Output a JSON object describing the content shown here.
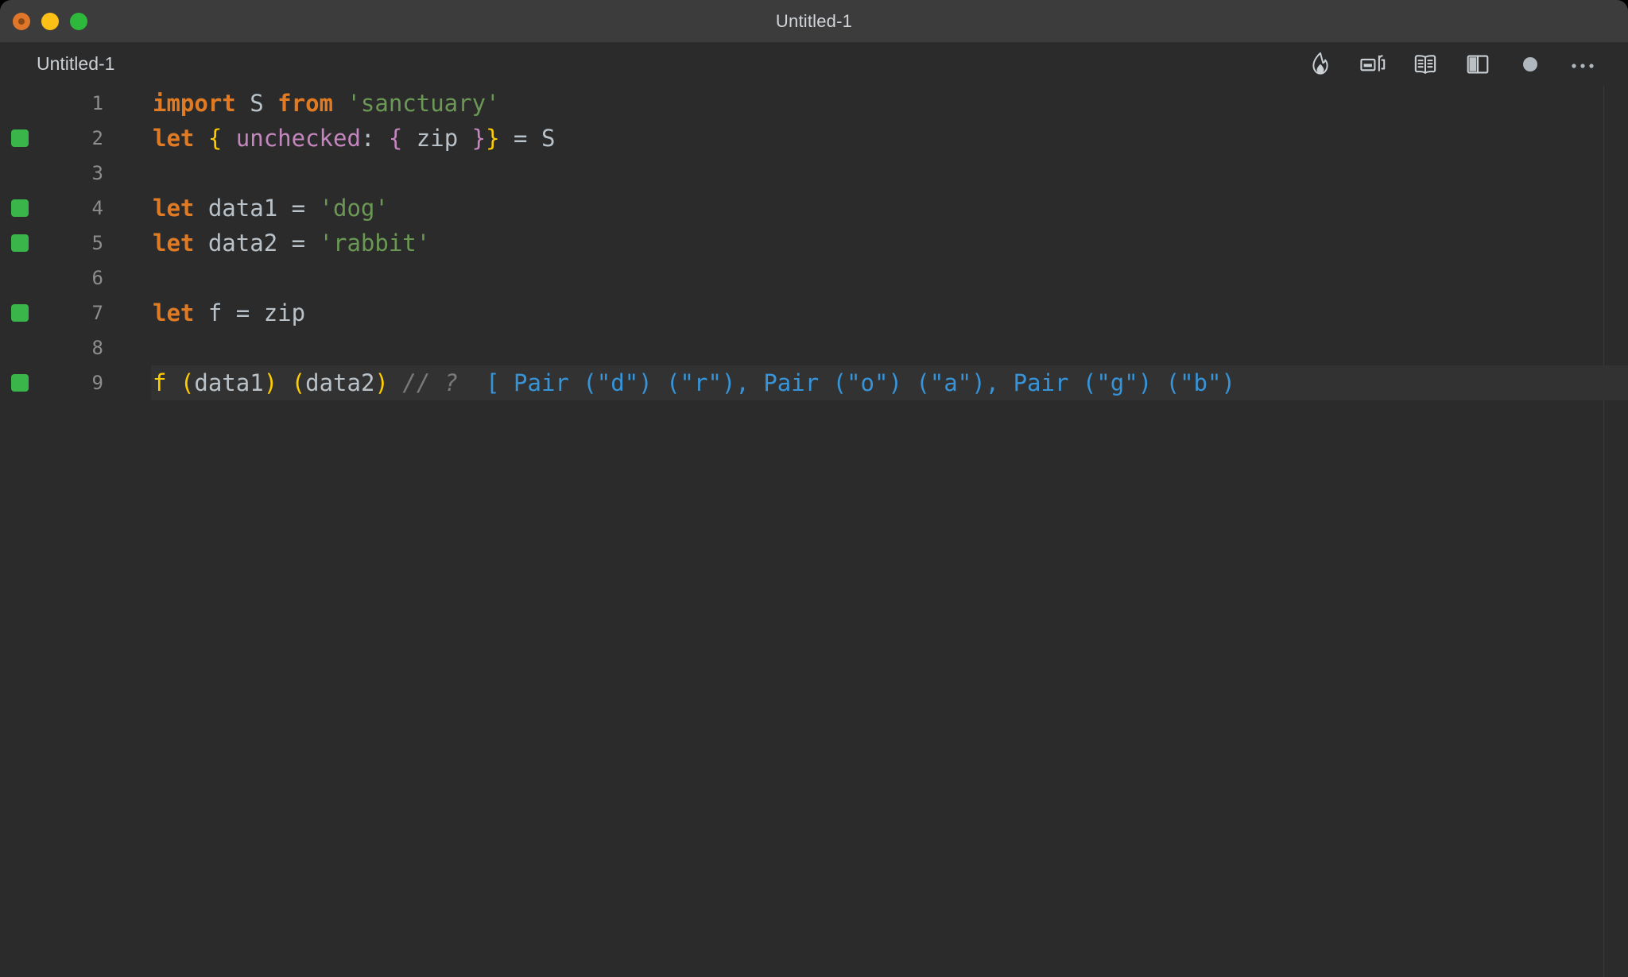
{
  "window": {
    "title": "Untitled-1",
    "traffic_lights": [
      {
        "name": "close",
        "color": "#e0762a"
      },
      {
        "name": "minimize",
        "color": "#fcc017"
      },
      {
        "name": "maximize",
        "color": "#2eb83c"
      }
    ]
  },
  "tabbar": {
    "tab_label": "Untitled-1",
    "tools": [
      {
        "name": "flame-icon",
        "title": "Flame"
      },
      {
        "name": "run-preview-icon",
        "title": "Run / Preview"
      },
      {
        "name": "book-icon",
        "title": "Reference"
      },
      {
        "name": "split-editor-icon",
        "title": "Split Editor"
      },
      {
        "name": "unsaved-dot-icon",
        "title": "Unsaved changes"
      },
      {
        "name": "more-menu-icon",
        "title": "More actions"
      }
    ]
  },
  "editor": {
    "language": "javascript",
    "active_line": 9,
    "lines": [
      {
        "number": "1",
        "marked": false,
        "active": false,
        "tokens": [
          {
            "c": "t-kw",
            "t": "import"
          },
          {
            "c": "t-plain",
            "t": " S "
          },
          {
            "c": "t-kw",
            "t": "from"
          },
          {
            "c": "t-plain",
            "t": " "
          },
          {
            "c": "t-str",
            "t": "'sanctuary'"
          }
        ]
      },
      {
        "number": "2",
        "marked": true,
        "active": false,
        "tokens": [
          {
            "c": "t-kw",
            "t": "let"
          },
          {
            "c": "t-plain",
            "t": " "
          },
          {
            "c": "t-brace-y",
            "t": "{"
          },
          {
            "c": "t-plain",
            "t": " "
          },
          {
            "c": "t-prop",
            "t": "unchecked"
          },
          {
            "c": "t-plain",
            "t": ": "
          },
          {
            "c": "t-brace-p",
            "t": "{"
          },
          {
            "c": "t-plain",
            "t": " zip "
          },
          {
            "c": "t-brace-p",
            "t": "}"
          },
          {
            "c": "t-brace-y",
            "t": "}"
          },
          {
            "c": "t-plain",
            "t": " = S"
          }
        ]
      },
      {
        "number": "3",
        "marked": false,
        "active": false,
        "tokens": []
      },
      {
        "number": "4",
        "marked": true,
        "active": false,
        "tokens": [
          {
            "c": "t-kw",
            "t": "let"
          },
          {
            "c": "t-plain",
            "t": " data1 = "
          },
          {
            "c": "t-str",
            "t": "'dog'"
          }
        ]
      },
      {
        "number": "5",
        "marked": true,
        "active": false,
        "tokens": [
          {
            "c": "t-kw",
            "t": "let"
          },
          {
            "c": "t-plain",
            "t": " data2 = "
          },
          {
            "c": "t-str",
            "t": "'rabbit'"
          }
        ]
      },
      {
        "number": "6",
        "marked": false,
        "active": false,
        "tokens": []
      },
      {
        "number": "7",
        "marked": true,
        "active": false,
        "tokens": [
          {
            "c": "t-kw",
            "t": "let"
          },
          {
            "c": "t-plain",
            "t": " f = zip"
          }
        ]
      },
      {
        "number": "8",
        "marked": false,
        "active": false,
        "tokens": []
      },
      {
        "number": "9",
        "marked": true,
        "active": true,
        "tokens": [
          {
            "c": "t-fn",
            "t": "f "
          },
          {
            "c": "t-paren",
            "t": "("
          },
          {
            "c": "t-plain",
            "t": "data1"
          },
          {
            "c": "t-paren",
            "t": ")"
          },
          {
            "c": "t-plain",
            "t": " "
          },
          {
            "c": "t-paren",
            "t": "("
          },
          {
            "c": "t-plain",
            "t": "data2"
          },
          {
            "c": "t-paren",
            "t": ")"
          },
          {
            "c": "t-plain",
            "t": " "
          },
          {
            "c": "t-comment",
            "t": "// ?"
          },
          {
            "c": "t-plain",
            "t": "  "
          },
          {
            "c": "t-out",
            "t": "[ Pair (\"d\") (\"r\"), Pair (\"o\") (\"a\"), Pair (\"g\") (\"b\")"
          }
        ]
      }
    ]
  },
  "colors": {
    "window_bg": "#2b2b2b",
    "titlebar_bg": "#3c3c3c",
    "active_line_bg": "#323232",
    "marker_green": "#39b54a",
    "keyword_orange": "#e07b24",
    "string_green": "#6b9955",
    "property_purple": "#c586c0",
    "bracket_yellow": "#ffcc00",
    "output_blue": "#3794d9",
    "comment_gray": "#7a7a7a",
    "text_gray": "#b9c2c8"
  }
}
